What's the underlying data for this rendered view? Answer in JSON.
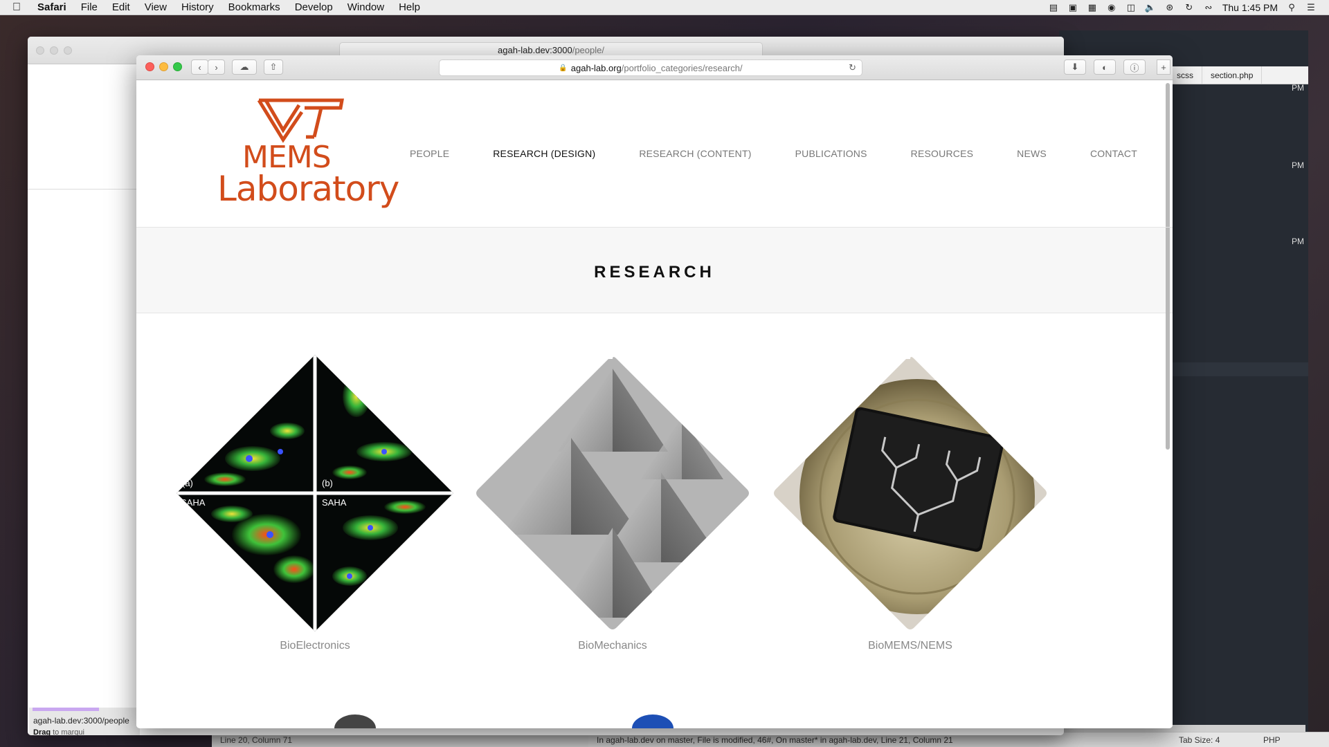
{
  "menubar": {
    "app_name": "Safari",
    "items": [
      "File",
      "Edit",
      "View",
      "History",
      "Bookmarks",
      "Develop",
      "Window",
      "Help"
    ],
    "clock": "Thu 1:45 PM"
  },
  "back_window": {
    "url_host": "agah-lab.dev:3000",
    "url_path": "/people/",
    "hover_url": "agah-lab.dev:3000/people",
    "drag_hint_bold": "Drag",
    "drag_hint": " to marqui"
  },
  "editor": {
    "tabs": [
      "scss",
      "section.php"
    ],
    "side_labels": [
      "PM",
      "PM",
      "PM"
    ],
    "status_msg": "In agah-lab.dev on master, File is modified, 46#, On master* in agah-lab.dev, Line 21, Column 21",
    "under_status": "Line 20, Column 71",
    "tab_size": "Tab Size: 4",
    "language": "PHP"
  },
  "browser": {
    "url_host": "agah-lab.org",
    "url_path": "/portfolio_categories/research/"
  },
  "site": {
    "logo_mems": "MEMS",
    "logo_lab": "Laboratory",
    "nav": [
      "PEOPLE",
      "RESEARCH (DESIGN)",
      "RESEARCH (CONTENT)",
      "PUBLICATIONS",
      "RESOURCES",
      "NEWS",
      "CONTACT"
    ],
    "active_nav": "RESEARCH (DESIGN)",
    "page_title": "RESEARCH",
    "portfolio": [
      {
        "caption": "BioElectronics",
        "labels": [
          "(a)",
          "(b)",
          "SAHA",
          "SAHA"
        ]
      },
      {
        "caption": "BioMechanics"
      },
      {
        "caption": "BioMEMS/NEMS"
      }
    ]
  },
  "colors": {
    "brand": "#d24c1b",
    "close": "#fc605b",
    "minimize": "#fdbc40",
    "maximize": "#34c84a"
  }
}
